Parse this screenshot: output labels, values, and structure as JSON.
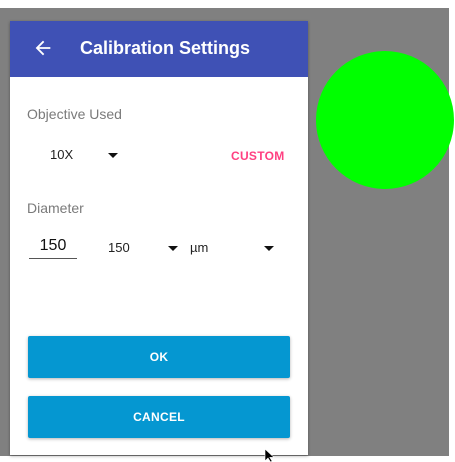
{
  "dialog": {
    "title": "Calibration Settings",
    "back_icon": "arrow-left-icon"
  },
  "objective": {
    "label": "Objective Used",
    "selected": "10X",
    "custom_label": "CUSTOM"
  },
  "diameter": {
    "label": "Diameter",
    "input_value": "150",
    "preset_selected": "150",
    "unit_selected": "µm"
  },
  "buttons": {
    "ok_label": "OK",
    "cancel_label": "CANCEL"
  },
  "colors": {
    "appbar": "#3f51b5",
    "accent": "#ff4081",
    "button": "#0597d1",
    "indicator": "#00ff00",
    "backdrop": "#808080"
  },
  "icons": {
    "dropdown": "chevron-down-icon",
    "cursor": "mouse-cursor-icon"
  }
}
